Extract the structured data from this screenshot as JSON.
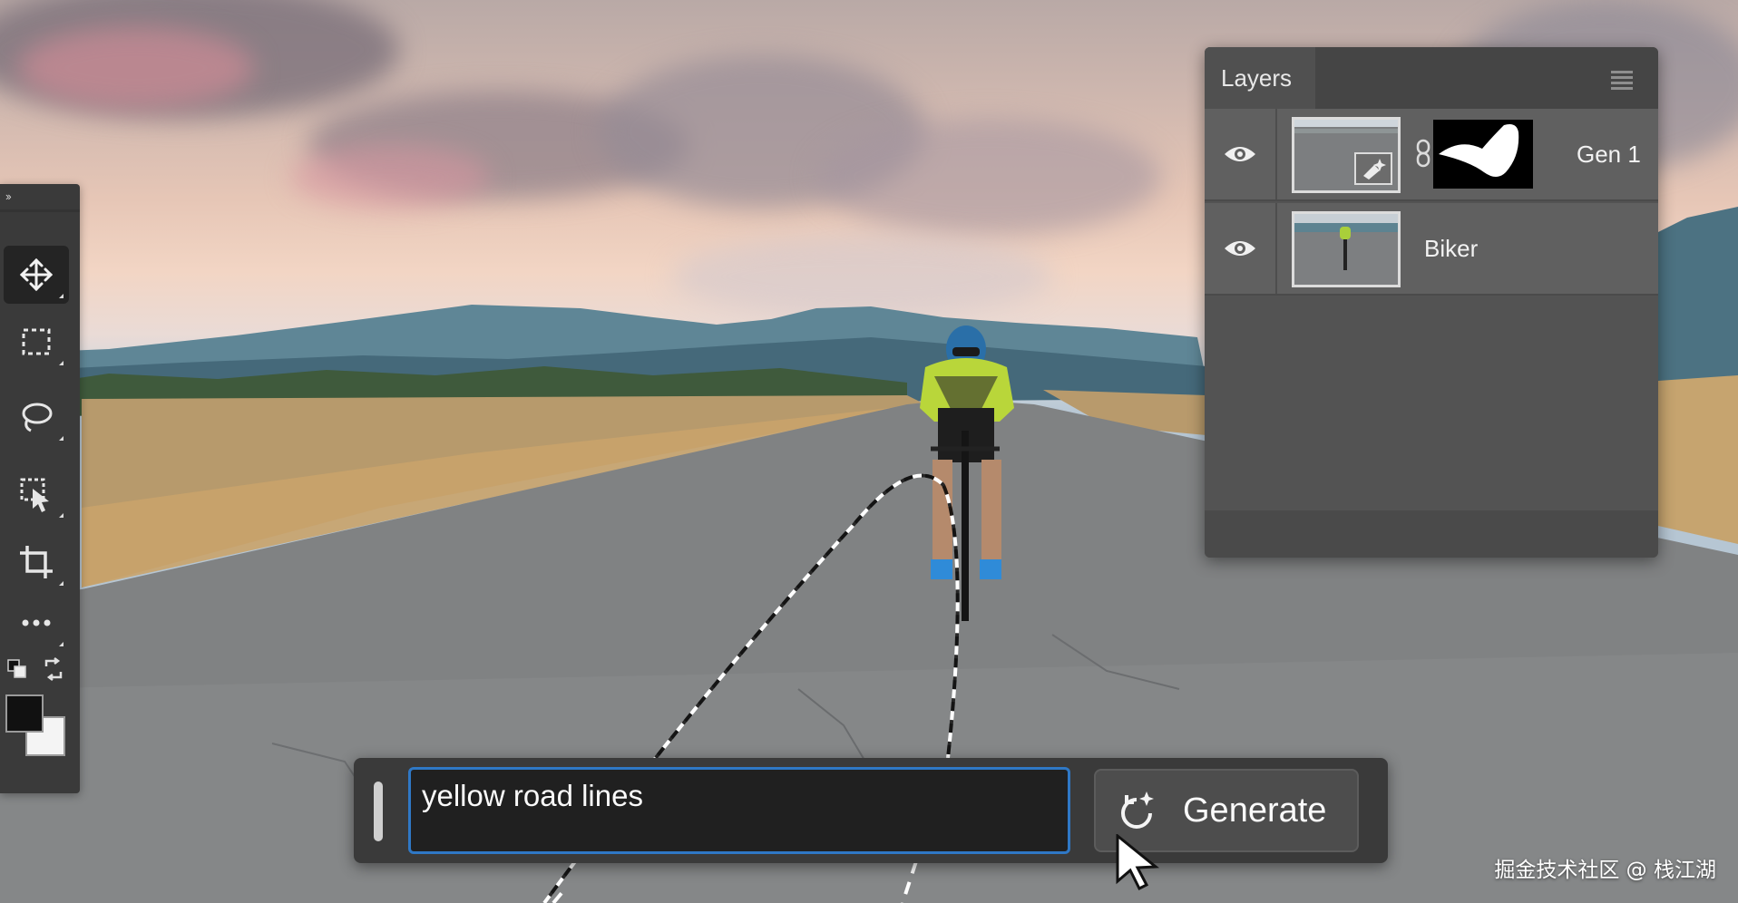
{
  "layers_panel": {
    "title": "Layers",
    "layers": [
      {
        "name": "Gen 1",
        "visible": true,
        "has_mask": true
      },
      {
        "name": "Biker",
        "visible": true,
        "has_mask": false
      }
    ]
  },
  "toolbar": {
    "tools": [
      {
        "icon": "move-icon",
        "active": true
      },
      {
        "icon": "marquee-icon",
        "active": false
      },
      {
        "icon": "lasso-icon",
        "active": false
      },
      {
        "icon": "object-selection-icon",
        "active": false
      },
      {
        "icon": "crop-icon",
        "active": false
      },
      {
        "icon": "more-tools-icon",
        "active": false
      }
    ],
    "foreground_color": "#111111",
    "background_color": "#f4f4f4"
  },
  "generate_bar": {
    "prompt_value": "yellow road lines",
    "button_label": "Generate",
    "accent": "#2f78c6"
  },
  "watermark": "掘金技术社区 @ 栈江湖"
}
